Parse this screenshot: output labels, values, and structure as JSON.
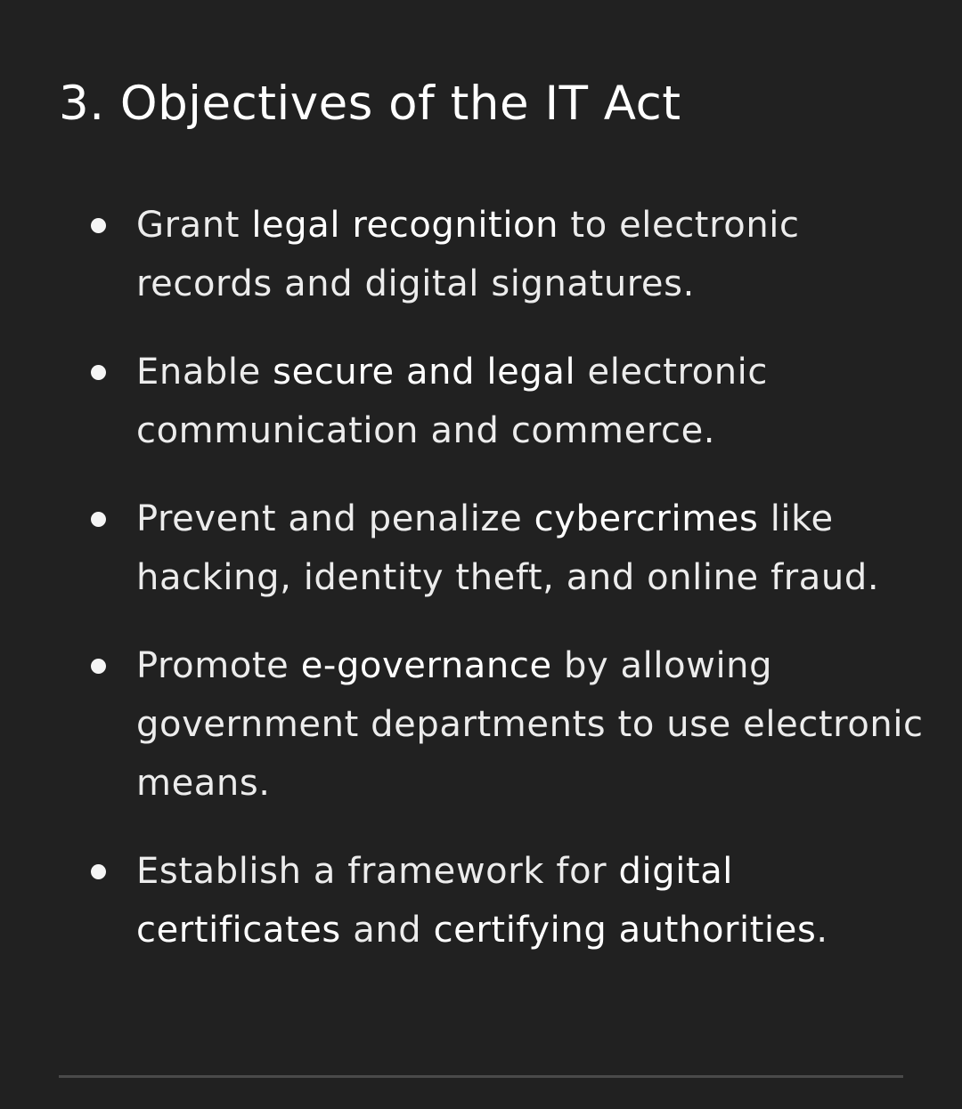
{
  "heading": "3. Objectives of the IT Act",
  "items": [
    {
      "segments": [
        {
          "text": "Grant ",
          "bold": false
        },
        {
          "text": "legal recognition",
          "bold": true
        },
        {
          "text": " to electronic records and digital signatures.",
          "bold": false
        }
      ]
    },
    {
      "segments": [
        {
          "text": "Enable ",
          "bold": false
        },
        {
          "text": "secure and legal",
          "bold": true
        },
        {
          "text": " electronic communication and commerce.",
          "bold": false
        }
      ]
    },
    {
      "segments": [
        {
          "text": "Prevent and penalize ",
          "bold": false
        },
        {
          "text": "cybercrimes",
          "bold": true
        },
        {
          "text": " like hacking, identity theft, and online fraud.",
          "bold": false
        }
      ]
    },
    {
      "segments": [
        {
          "text": "Promote ",
          "bold": false
        },
        {
          "text": "e-governance",
          "bold": true
        },
        {
          "text": " by allowing government departments to use electronic means.",
          "bold": false
        }
      ]
    },
    {
      "segments": [
        {
          "text": "Establish a framework for ",
          "bold": false
        },
        {
          "text": "digital certificates",
          "bold": true
        },
        {
          "text": " and ",
          "bold": false
        },
        {
          "text": "certifying authorities",
          "bold": true
        },
        {
          "text": ".",
          "bold": false
        }
      ]
    }
  ],
  "colors": {
    "background": "#212121",
    "text": "#ececec",
    "divider": "#4a4a4a"
  }
}
